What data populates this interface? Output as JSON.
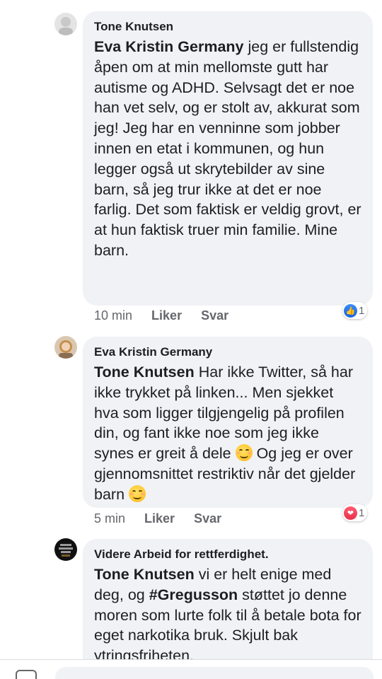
{
  "comments": [
    {
      "author": "Tone Knutsen",
      "mention": "Eva Kristin Germany",
      "body": " jeg er fullstendig åpen om at min mellomste gutt har autisme og ADHD. Selvsagt det er noe han vet selv, og er stolt av, akkurat som jeg! Jeg har en venninne som jobber innen en etat i kommunen, og hun legger også ut skrytebilder av sine barn, så jeg trur ikke at det er noe farlig. Det som faktisk er veldig grovt, er at hun faktisk truer min familie. Mine barn.",
      "time": "10 min",
      "like_label": "Liker",
      "reply_label": "Svar",
      "reaction_icon": "thumbs-up-icon",
      "reaction_count": "1"
    },
    {
      "author": "Eva Kristin Germany",
      "mention": "Tone Knutsen",
      "body_part1": " Har ikke Twitter, så har ikke trykket på linken... Men sjekket hva som ligger tilgjengelig på profilen din, og fant ikke noe som jeg ikke synes er greit å dele ",
      "body_part2": " Og jeg er over gjennomsnittet restriktiv når det gjelder barn ",
      "time": "5 min",
      "like_label": "Liker",
      "reply_label": "Svar",
      "reaction_icon": "heart-icon",
      "reaction_count": "1"
    },
    {
      "author": "Videre Arbeid for rettferdighet.",
      "mention": "Tone Knutsen",
      "body_part1": " vi er helt enige med deg, og ",
      "hashtag": "#Gregusson",
      "body_part2": " støttet jo denne moren som lurte folk til å betale bota for eget narkotika bruk. Skjult bak ytringsfriheten."
    }
  ]
}
